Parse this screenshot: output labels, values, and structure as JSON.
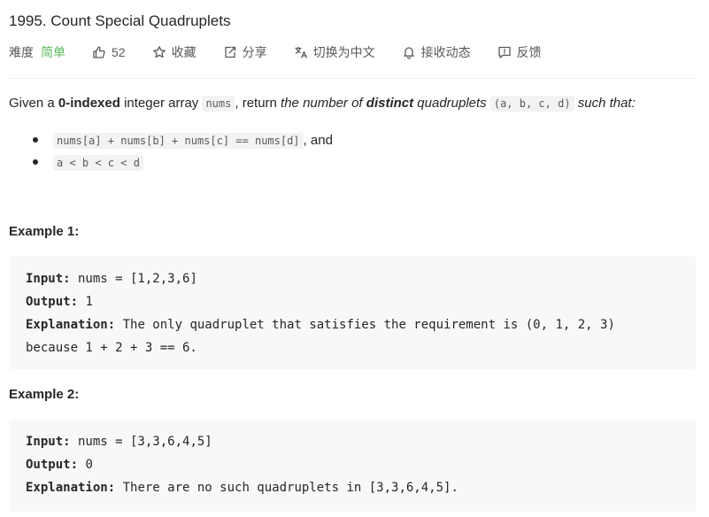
{
  "problem": {
    "title": "1995. Count Special Quadruplets"
  },
  "meta": {
    "difficulty_label": "难度",
    "difficulty_value": "简单",
    "likes": "52",
    "favorite": "收藏",
    "share": "分享",
    "translate": "切换为中文",
    "notify": "接收动态",
    "feedback": "反馈"
  },
  "description": {
    "p1": "Given a ",
    "bold1": "0-indexed",
    "p2": " integer array ",
    "code1": "nums",
    "p3": ", return ",
    "em1": "the number of ",
    "emb1": "distinct",
    "em2": " quadruplets",
    "code2": "(a, b, c, d)",
    "em3": " such that:"
  },
  "conditions": [
    {
      "code": "nums[a] + nums[b] + nums[c] == nums[d]",
      "suffix": ", and"
    },
    {
      "code": "a < b < c < d",
      "suffix": ""
    }
  ],
  "examples": [
    {
      "title": "Example 1:",
      "input_label": "Input:",
      "input": " nums = [1,2,3,6]",
      "output_label": "Output:",
      "output": " 1",
      "explanation_label": "Explanation:",
      "explanation": " The only quadruplet that satisfies the requirement is (0, 1, 2, 3)",
      "explanation_cont": "because 1 + 2 + 3 == 6."
    },
    {
      "title": "Example 2:",
      "input_label": "Input:",
      "input": " nums = [3,3,6,4,5]",
      "output_label": "Output:",
      "output": " 0",
      "explanation_label": "Explanation:",
      "explanation": " There are no such quadruplets in [3,3,6,4,5]."
    }
  ],
  "colors": {
    "easy": "#5cb85c",
    "text": "#262626",
    "code_bg": "#f3f3f3",
    "pre_bg": "#f7f8fa"
  },
  "icons": [
    "thumbs-up-icon",
    "star-icon",
    "share-icon",
    "translate-icon",
    "bell-icon",
    "feedback-icon"
  ]
}
